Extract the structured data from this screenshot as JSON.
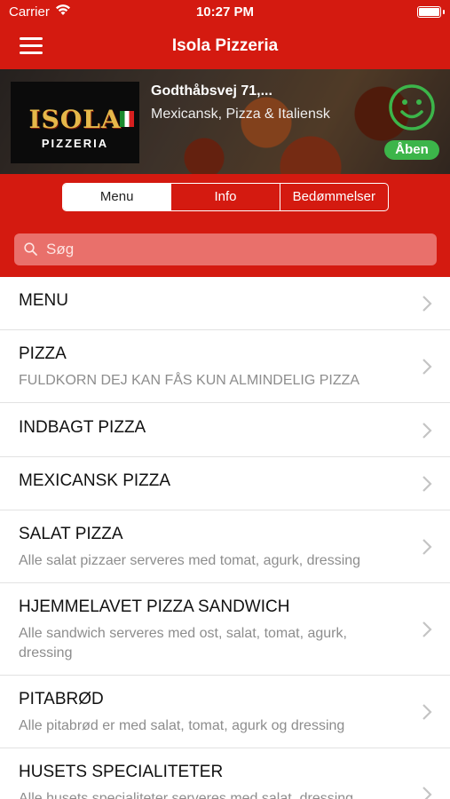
{
  "status_bar": {
    "carrier": "Carrier",
    "time": "10:27 PM"
  },
  "nav": {
    "title": "Isola Pizzeria"
  },
  "restaurant": {
    "logo_text": "ISOLA",
    "logo_subtext": "PIZZERIA",
    "address": "Godthåbsvej 71,...",
    "cuisine": "Mexicansk, Pizza & Italiensk",
    "status": "Åben"
  },
  "tabs": [
    {
      "label": "Menu",
      "selected": true
    },
    {
      "label": "Info",
      "selected": false
    },
    {
      "label": "Bedømmelser",
      "selected": false
    }
  ],
  "search": {
    "placeholder": "Søg"
  },
  "menu_items": [
    {
      "name": "MENU",
      "description": ""
    },
    {
      "name": "PIZZA",
      "description": "FULDKORN DEJ KAN FÅS KUN ALMINDELIG PIZZA"
    },
    {
      "name": "INDBAGT PIZZA",
      "description": ""
    },
    {
      "name": "MEXICANSK PIZZA",
      "description": ""
    },
    {
      "name": "SALAT PIZZA",
      "description": "Alle salat pizzaer serveres med tomat, agurk, dressing"
    },
    {
      "name": "HJEMMELAVET PIZZA SANDWICH",
      "description": "Alle sandwich serveres med ost, salat, tomat, agurk, dressing"
    },
    {
      "name": "PITABRØD",
      "description": "Alle pitabrød er med salat, tomat, agurk og dressing"
    },
    {
      "name": "HUSETS SPECIALITETER",
      "description": "Alle husets specialiteter serveres med salat, dressing"
    }
  ],
  "colors": {
    "brand_red": "#d41a10",
    "open_green": "#3cb54a"
  },
  "icons": [
    "wifi-icon",
    "battery-icon",
    "hamburger-menu-icon",
    "smiley-icon",
    "search-icon",
    "chevron-right-icon"
  ]
}
